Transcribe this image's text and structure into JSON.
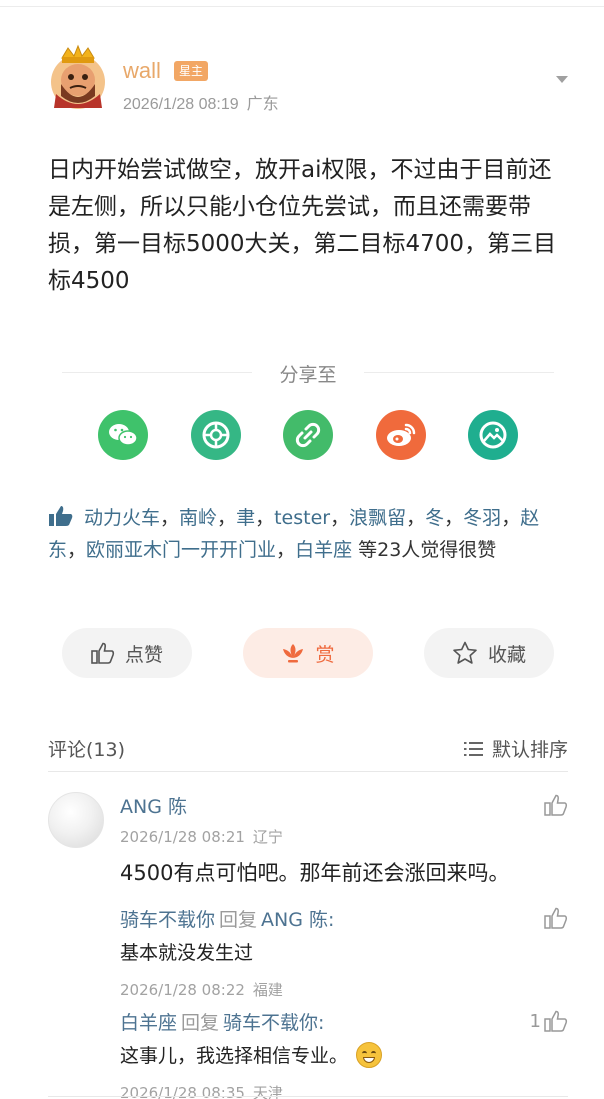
{
  "post": {
    "author": {
      "name": "wall",
      "badge": "星主"
    },
    "time": "2026/1/28 08:19",
    "location": "广东",
    "content": "日内开始尝试做空，放开ai权限，不过由于目前还是左侧，所以只能小仓位先尝试，而且还需要带损，第一目标5000大关，第二目标4700，第三目标4500"
  },
  "share": {
    "title": "分享至",
    "targets": [
      "wechat-icon",
      "moments-icon",
      "link-icon",
      "weibo-icon",
      "album-icon"
    ],
    "colors": {
      "wechat": "#3fc26b",
      "moments": "#35b785",
      "link": "#43bb6a",
      "weibo": "#f06a3c",
      "album": "#1fae8f"
    }
  },
  "likes": {
    "names": [
      "动力火车",
      "南岭",
      "聿",
      "tester",
      "浪飘留",
      "冬",
      "冬羽",
      "赵东",
      "欧丽亚木门一开开门业",
      "白羊座"
    ],
    "separator": "，",
    "suffix": "等23人觉得很赞"
  },
  "actions": {
    "like": "点赞",
    "reward": "赏",
    "favorite": "收藏"
  },
  "comments_header": {
    "title": "评论(13)",
    "sort": "默认排序"
  },
  "comment": {
    "author": "ANG 陈",
    "time": "2026/1/28 08:21",
    "location": "辽宁",
    "text": "4500有点可怕吧。那年前还会涨回来吗。"
  },
  "replies": [
    {
      "from": "骑车不载你",
      "reply_word": "回复",
      "to": "ANG 陈",
      "colon": ":",
      "text": "基本就没发生过",
      "time": "2026/1/28 08:22",
      "location": "福建",
      "likes": ""
    },
    {
      "from": "白羊座",
      "reply_word": "回复",
      "to": "骑车不载你",
      "colon": ":",
      "text": "这事儿，我选择相信专业。",
      "time": "2026/1/28 08:35",
      "location": "天津",
      "likes": "1"
    }
  ],
  "colors": {
    "accent_orange": "#e8a86a",
    "link_blue": "#4d7391",
    "reward_red": "#ef6a3e"
  }
}
